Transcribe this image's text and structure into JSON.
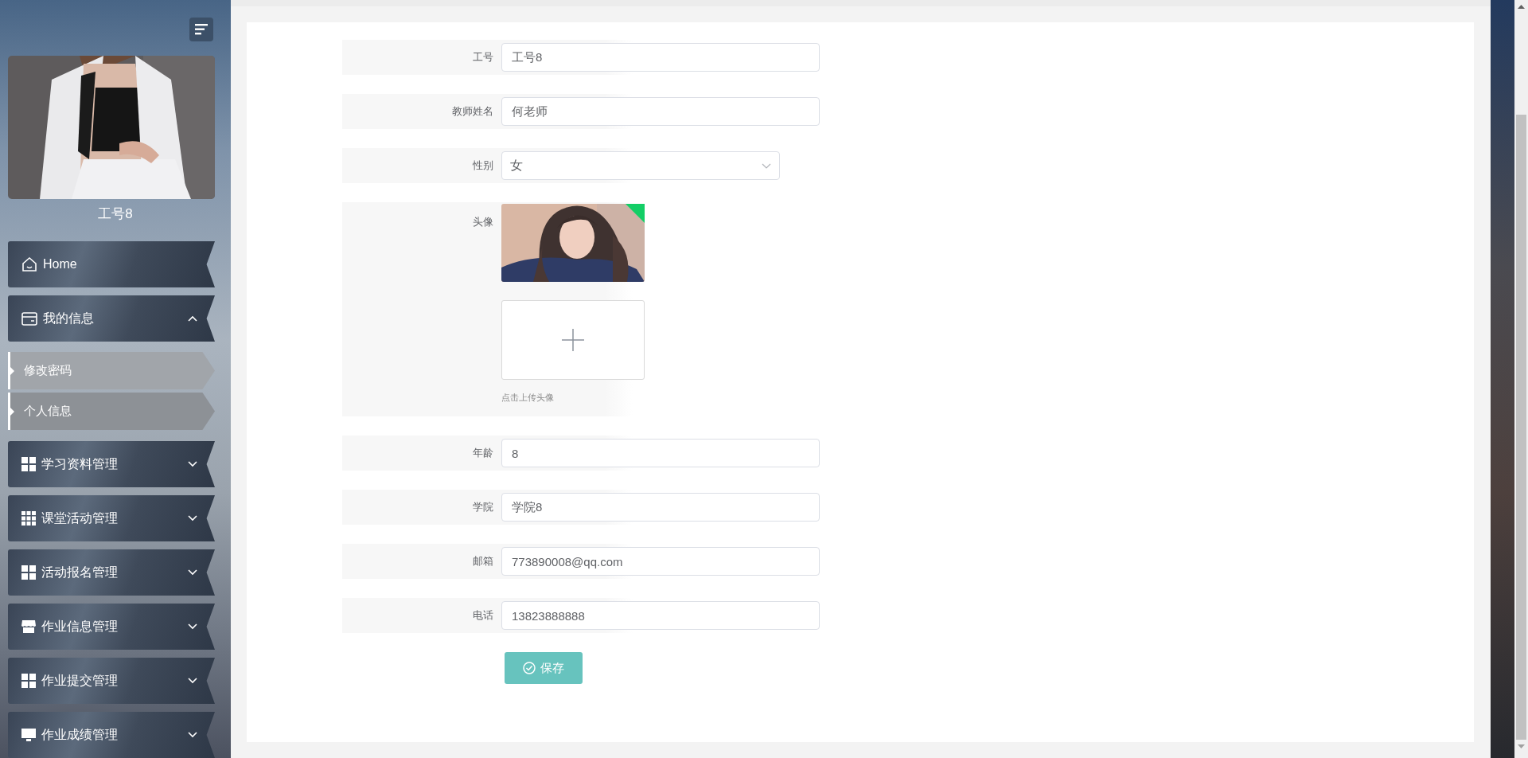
{
  "sidebar": {
    "username": "工号8",
    "menu": [
      {
        "kind": "link",
        "label": "Home"
      },
      {
        "kind": "group",
        "label": "我的信息",
        "expanded": true,
        "children": [
          {
            "label": "修改密码",
            "selected": false
          },
          {
            "label": "个人信息",
            "selected": true
          }
        ]
      },
      {
        "kind": "group",
        "label": "学习资料管理",
        "expanded": false
      },
      {
        "kind": "group",
        "label": "课堂活动管理",
        "expanded": false
      },
      {
        "kind": "group",
        "label": "活动报名管理",
        "expanded": false
      },
      {
        "kind": "group",
        "label": "作业信息管理",
        "expanded": false
      },
      {
        "kind": "group",
        "label": "作业提交管理",
        "expanded": false
      },
      {
        "kind": "group",
        "label": "作业成绩管理",
        "expanded": false
      }
    ]
  },
  "form": {
    "fields": [
      {
        "kind": "text",
        "label": "工号",
        "value": "工号8"
      },
      {
        "kind": "text",
        "label": "教师姓名",
        "value": "何老师"
      },
      {
        "kind": "select",
        "label": "性别",
        "value": "女"
      },
      {
        "kind": "upload",
        "label": "头像",
        "uploaded": true,
        "hint": "点击上传头像"
      },
      {
        "kind": "text",
        "label": "年龄",
        "value": "8"
      },
      {
        "kind": "text",
        "label": "学院",
        "value": "学院8"
      },
      {
        "kind": "text",
        "label": "邮箱",
        "value": "773890008@qq.com"
      },
      {
        "kind": "text",
        "label": "电话",
        "value": "13823888888"
      }
    ],
    "submit": "保存"
  }
}
